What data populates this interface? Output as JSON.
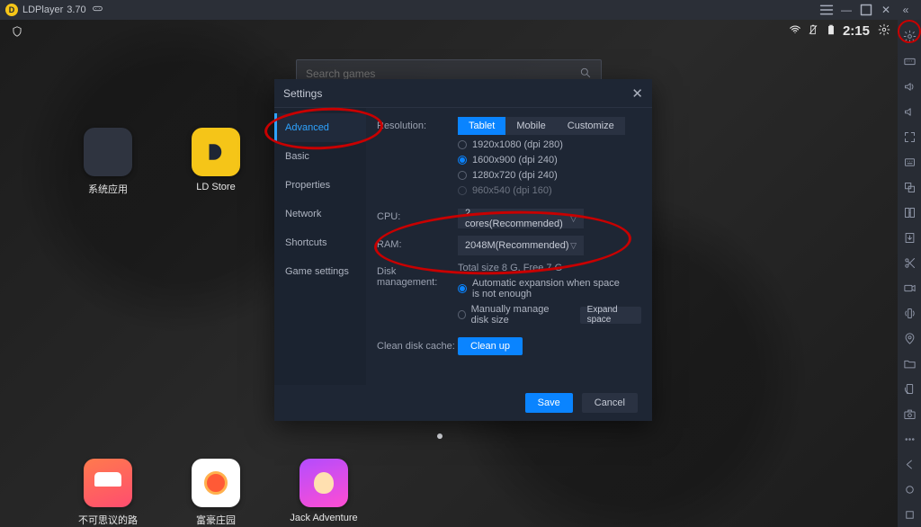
{
  "titlebar": {
    "app_name": "LDPlayer",
    "version": "3.70"
  },
  "status": {
    "clock": "2:15"
  },
  "search": {
    "placeholder": "Search games"
  },
  "desktop": {
    "icons": [
      {
        "label": "系统应用"
      },
      {
        "label": "LD Store"
      },
      {
        "label": "不可思议的路"
      },
      {
        "label": "富豪庄园"
      },
      {
        "label": "Jack Adventure"
      }
    ]
  },
  "settings": {
    "title": "Settings",
    "tabs": [
      "Advanced",
      "Basic",
      "Properties",
      "Network",
      "Shortcuts",
      "Game settings"
    ],
    "active_tab": "Advanced",
    "resolution": {
      "label": "Resolution:",
      "modes": [
        "Tablet",
        "Mobile",
        "Customize"
      ],
      "active_mode": "Tablet",
      "options": [
        "1920x1080  (dpi 280)",
        "1600x900  (dpi 240)",
        "1280x720  (dpi 240)",
        "960x540  (dpi 160)"
      ],
      "selected_index": 1
    },
    "cpu": {
      "label": "CPU:",
      "value": "2 cores(Recommended)"
    },
    "ram": {
      "label": "RAM:",
      "value": "2048M(Recommended)"
    },
    "disk": {
      "label": "Disk management:",
      "status": "Total size 8 G,  Free 7 G",
      "opt_auto": "Automatic expansion when space is not enough",
      "opt_manual": "Manually manage disk size",
      "expand_btn": "Expand space"
    },
    "cache": {
      "label": "Clean disk cache:",
      "btn": "Clean up"
    },
    "save": "Save",
    "cancel": "Cancel"
  }
}
